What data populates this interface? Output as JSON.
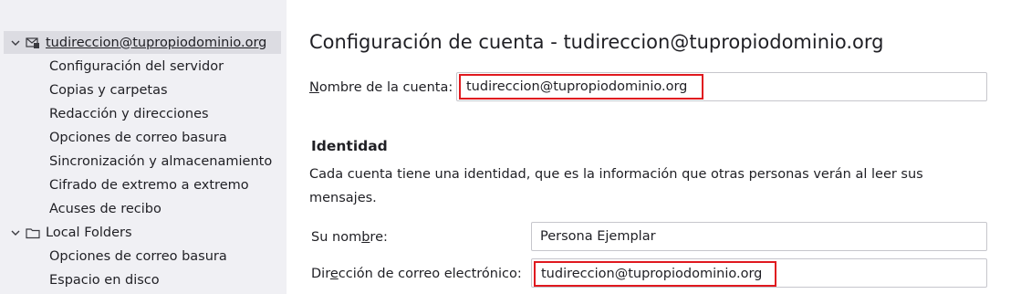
{
  "sidebar": {
    "account": {
      "label_user": "tudireccion",
      "label_at": "@",
      "label_domain": "tupropiodominio.org",
      "children": [
        "Configuración del servidor",
        "Copias y carpetas",
        "Redacción y direcciones",
        "Opciones de correo basura",
        "Sincronización y almacenamiento",
        "Cifrado de extremo a extremo",
        "Acuses de recibo"
      ]
    },
    "local_folders": {
      "label": "Local Folders",
      "children": [
        "Opciones de correo basura",
        "Espacio en disco"
      ]
    }
  },
  "main": {
    "title": "Configuración de cuenta - tudireccion@tupropiodominio.org",
    "account_name": {
      "label_pre": "",
      "label_key": "N",
      "label_post": "ombre de la cuenta:",
      "value": "tudireccion@tupropiodominio.org"
    },
    "identity": {
      "heading": "Identidad",
      "description": "Cada cuenta tiene una identidad, que es la información que otras personas verán al leer sus mensajes.",
      "name_field": {
        "label_pre": "Su nom",
        "label_key": "b",
        "label_post": "re:",
        "value": "Persona Ejemplar"
      },
      "email_field": {
        "label_pre": "Dir",
        "label_key": "e",
        "label_post": "cción de correo electrónico:",
        "value": "tudireccion@tupropiodominio.org"
      }
    }
  },
  "colors": {
    "sidebar_bg": "#f0f0f4",
    "selected_row": "#dcdce2",
    "highlight_box": "#e0191f"
  }
}
